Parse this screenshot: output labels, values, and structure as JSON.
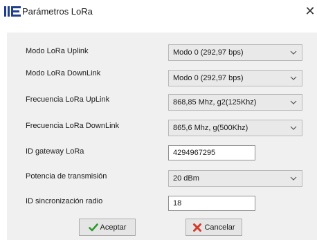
{
  "window": {
    "title": "Parámetros LoRa",
    "close_glyph": "✕",
    "logo_icon": "ie-logo-icon",
    "accent_color": "#1f3f8c"
  },
  "form": {
    "uplink_mode": {
      "label": "Modo LoRa Uplink",
      "value": "Modo 0 (292,97 bps)"
    },
    "downlink_mode": {
      "label": "Modo LoRa DownLink",
      "value": "Modo 0 (292,97 bps)"
    },
    "uplink_freq": {
      "label": "Frecuencia LoRa UpLink",
      "value": "868,85 Mhz, g2(125Khz)"
    },
    "downlink_freq": {
      "label": "Frecuencia LoRa DownLink",
      "value": "865,6 Mhz, g(500Khz)"
    },
    "gateway_id": {
      "label": "ID gateway LoRa",
      "value": "4294967295"
    },
    "tx_power": {
      "label": "Potencia de transmisión",
      "value": "20 dBm"
    },
    "sync_id": {
      "label": "ID sincronización radio",
      "value": "18"
    }
  },
  "buttons": {
    "accept": {
      "label": "Aceptar",
      "icon": "checkmark-icon",
      "color": "#2e9a2e"
    },
    "cancel": {
      "label": "Cancelar",
      "icon": "cancel-x-icon",
      "color": "#d43a2a"
    }
  }
}
